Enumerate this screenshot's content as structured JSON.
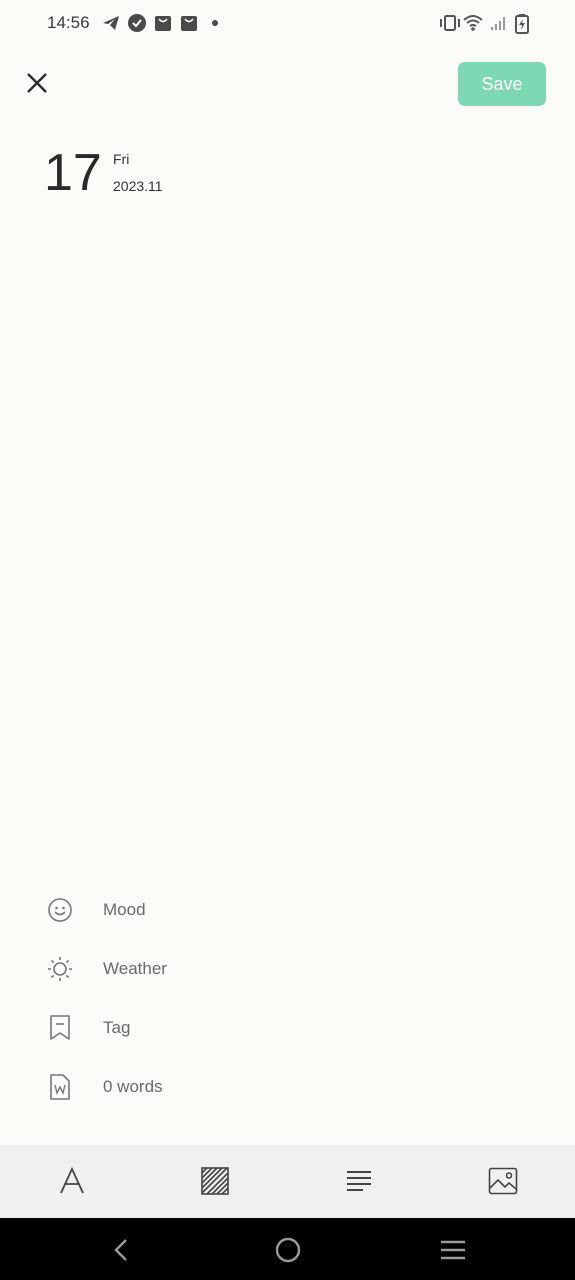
{
  "status_bar": {
    "time": "14:56",
    "icons": [
      "telegram-icon",
      "check-badge-icon",
      "shopping-bag-icon",
      "shopping-bag-icon",
      "dot-icon",
      "vibrate-icon",
      "wifi-icon",
      "signal-icon",
      "battery-charging-icon"
    ]
  },
  "header": {
    "close_icon": "close-icon",
    "save_label": "Save",
    "save_color": "#7fd8b4"
  },
  "date": {
    "day": "17",
    "weekday": "Fri",
    "year_month": "2023.11"
  },
  "meta": [
    {
      "icon": "smiley-icon",
      "label": "Mood"
    },
    {
      "icon": "sun-icon",
      "label": "Weather"
    },
    {
      "icon": "bookmark-icon",
      "label": "Tag"
    },
    {
      "icon": "word-document-icon",
      "label": "0 words"
    }
  ],
  "toolbar": {
    "items": [
      "text-format-icon",
      "pattern-background-icon",
      "align-text-icon",
      "image-icon"
    ],
    "background": "#eef1ed"
  },
  "nav_bar": {
    "items": [
      "back-icon",
      "home-icon",
      "menu-icon"
    ]
  }
}
